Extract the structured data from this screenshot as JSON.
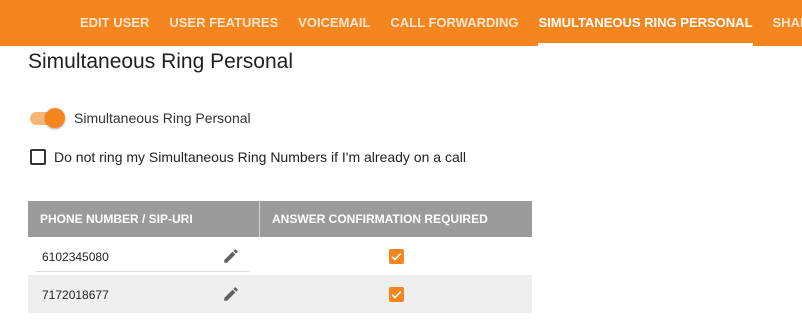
{
  "tabs": [
    {
      "label": "EDIT USER",
      "active": false
    },
    {
      "label": "USER FEATURES",
      "active": false
    },
    {
      "label": "VOICEMAIL",
      "active": false
    },
    {
      "label": "CALL FORWARDING",
      "active": false
    },
    {
      "label": "SIMULTANEOUS RING PERSONAL",
      "active": true
    },
    {
      "label": "SHAR",
      "active": false
    }
  ],
  "page": {
    "title": "Simultaneous Ring Personal"
  },
  "toggle": {
    "label": "Simultaneous Ring Personal",
    "on": true
  },
  "do_not_ring": {
    "label": "Do not ring my Simultaneous Ring Numbers if I'm already on a call",
    "checked": false
  },
  "table": {
    "headers": [
      "PHONE NUMBER / SIP-URI",
      "ANSWER CONFIRMATION REQUIRED"
    ],
    "rows": [
      {
        "number": "6102345080",
        "confirmation_required": true
      },
      {
        "number": "7172018677",
        "confirmation_required": true
      }
    ]
  },
  "colors": {
    "accent": "#f5851f",
    "header_gray": "#9b9b9b",
    "row_alt": "#efefef"
  },
  "icons": {
    "edit": "pencil-icon",
    "check": "checkmark-icon"
  }
}
